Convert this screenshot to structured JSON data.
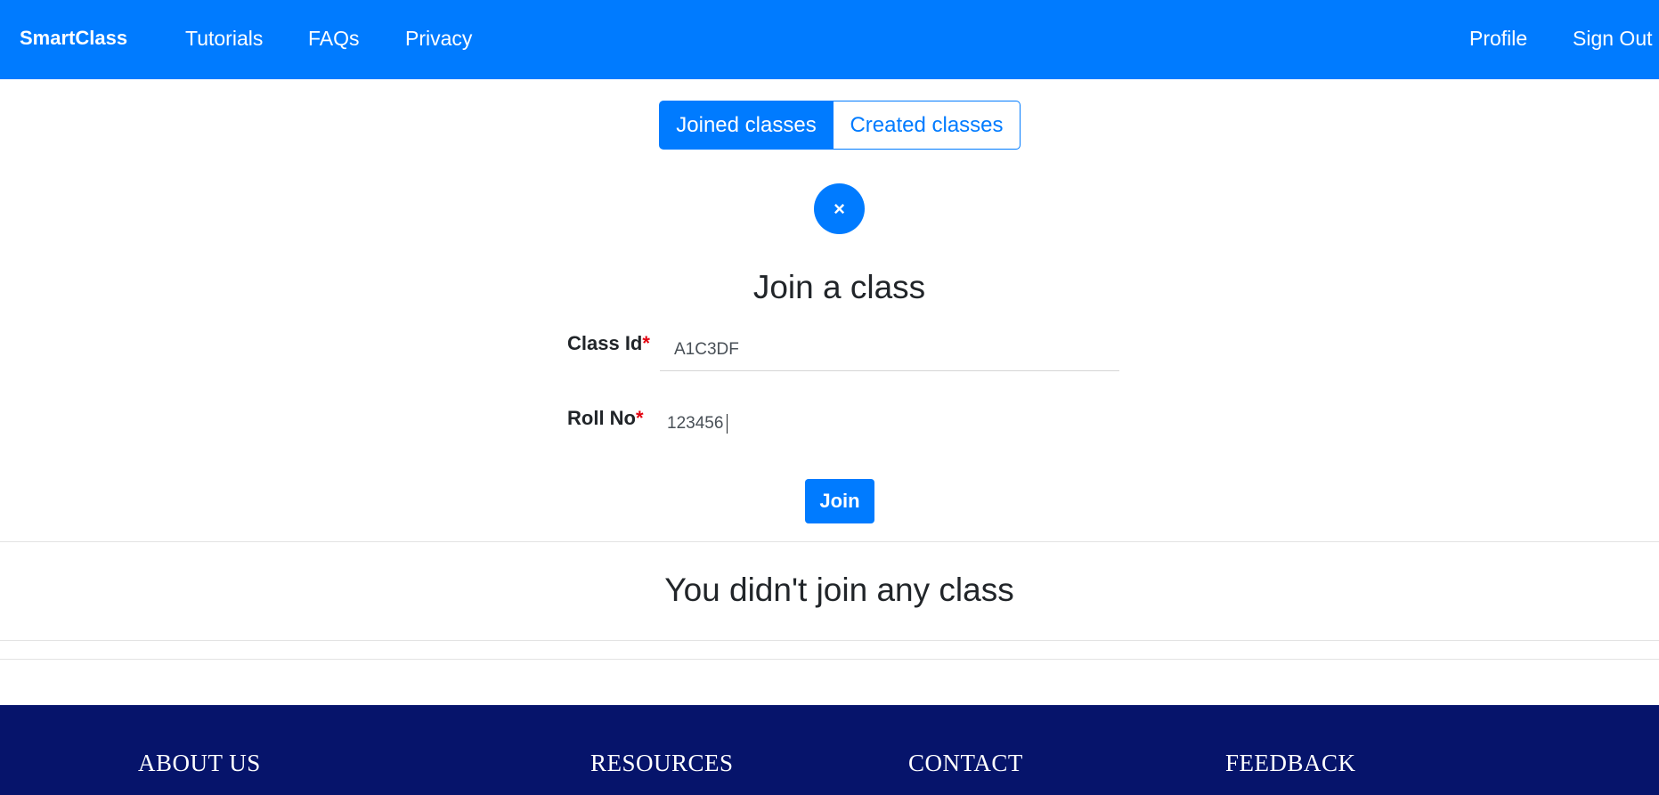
{
  "navbar": {
    "brand": "SmartClass",
    "links": [
      "Tutorials",
      "FAQs",
      "Privacy"
    ],
    "right_links": [
      "Profile",
      "Sign Out"
    ]
  },
  "tabs": {
    "joined": "Joined classes",
    "created": "Created classes"
  },
  "close_symbol": "×",
  "form": {
    "title": "Join a class",
    "class_id_label": "Class Id",
    "class_id_value": "A1C3DF",
    "roll_no_label": "Roll No",
    "roll_no_value": "123456",
    "required_marker": "*",
    "join_button": "Join"
  },
  "empty_message": "You didn't join any class",
  "footer": {
    "headings": [
      "ABOUT US",
      "RESOURCES",
      "CONTACT",
      "FEEDBACK"
    ]
  },
  "colors": {
    "primary": "#007bff",
    "footer": "#06146b",
    "required": "#e3000f"
  }
}
